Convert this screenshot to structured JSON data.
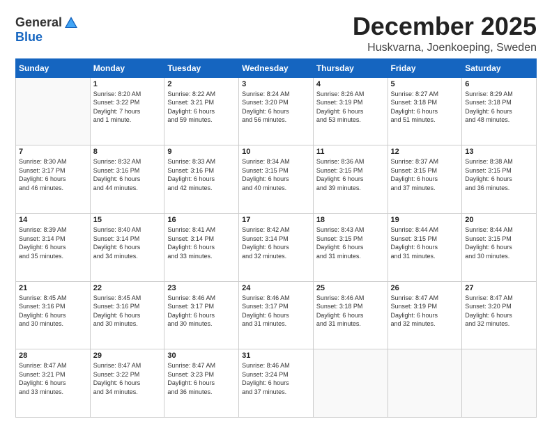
{
  "header": {
    "logo_general": "General",
    "logo_blue": "Blue",
    "month": "December 2025",
    "location": "Huskvarna, Joenkoeping, Sweden"
  },
  "days_of_week": [
    "Sunday",
    "Monday",
    "Tuesday",
    "Wednesday",
    "Thursday",
    "Friday",
    "Saturday"
  ],
  "weeks": [
    [
      {
        "day": "",
        "info": ""
      },
      {
        "day": "1",
        "info": "Sunrise: 8:20 AM\nSunset: 3:22 PM\nDaylight: 7 hours\nand 1 minute."
      },
      {
        "day": "2",
        "info": "Sunrise: 8:22 AM\nSunset: 3:21 PM\nDaylight: 6 hours\nand 59 minutes."
      },
      {
        "day": "3",
        "info": "Sunrise: 8:24 AM\nSunset: 3:20 PM\nDaylight: 6 hours\nand 56 minutes."
      },
      {
        "day": "4",
        "info": "Sunrise: 8:26 AM\nSunset: 3:19 PM\nDaylight: 6 hours\nand 53 minutes."
      },
      {
        "day": "5",
        "info": "Sunrise: 8:27 AM\nSunset: 3:18 PM\nDaylight: 6 hours\nand 51 minutes."
      },
      {
        "day": "6",
        "info": "Sunrise: 8:29 AM\nSunset: 3:18 PM\nDaylight: 6 hours\nand 48 minutes."
      }
    ],
    [
      {
        "day": "7",
        "info": "Sunrise: 8:30 AM\nSunset: 3:17 PM\nDaylight: 6 hours\nand 46 minutes."
      },
      {
        "day": "8",
        "info": "Sunrise: 8:32 AM\nSunset: 3:16 PM\nDaylight: 6 hours\nand 44 minutes."
      },
      {
        "day": "9",
        "info": "Sunrise: 8:33 AM\nSunset: 3:16 PM\nDaylight: 6 hours\nand 42 minutes."
      },
      {
        "day": "10",
        "info": "Sunrise: 8:34 AM\nSunset: 3:15 PM\nDaylight: 6 hours\nand 40 minutes."
      },
      {
        "day": "11",
        "info": "Sunrise: 8:36 AM\nSunset: 3:15 PM\nDaylight: 6 hours\nand 39 minutes."
      },
      {
        "day": "12",
        "info": "Sunrise: 8:37 AM\nSunset: 3:15 PM\nDaylight: 6 hours\nand 37 minutes."
      },
      {
        "day": "13",
        "info": "Sunrise: 8:38 AM\nSunset: 3:15 PM\nDaylight: 6 hours\nand 36 minutes."
      }
    ],
    [
      {
        "day": "14",
        "info": "Sunrise: 8:39 AM\nSunset: 3:14 PM\nDaylight: 6 hours\nand 35 minutes."
      },
      {
        "day": "15",
        "info": "Sunrise: 8:40 AM\nSunset: 3:14 PM\nDaylight: 6 hours\nand 34 minutes."
      },
      {
        "day": "16",
        "info": "Sunrise: 8:41 AM\nSunset: 3:14 PM\nDaylight: 6 hours\nand 33 minutes."
      },
      {
        "day": "17",
        "info": "Sunrise: 8:42 AM\nSunset: 3:14 PM\nDaylight: 6 hours\nand 32 minutes."
      },
      {
        "day": "18",
        "info": "Sunrise: 8:43 AM\nSunset: 3:15 PM\nDaylight: 6 hours\nand 31 minutes."
      },
      {
        "day": "19",
        "info": "Sunrise: 8:44 AM\nSunset: 3:15 PM\nDaylight: 6 hours\nand 31 minutes."
      },
      {
        "day": "20",
        "info": "Sunrise: 8:44 AM\nSunset: 3:15 PM\nDaylight: 6 hours\nand 30 minutes."
      }
    ],
    [
      {
        "day": "21",
        "info": "Sunrise: 8:45 AM\nSunset: 3:16 PM\nDaylight: 6 hours\nand 30 minutes."
      },
      {
        "day": "22",
        "info": "Sunrise: 8:45 AM\nSunset: 3:16 PM\nDaylight: 6 hours\nand 30 minutes."
      },
      {
        "day": "23",
        "info": "Sunrise: 8:46 AM\nSunset: 3:17 PM\nDaylight: 6 hours\nand 30 minutes."
      },
      {
        "day": "24",
        "info": "Sunrise: 8:46 AM\nSunset: 3:17 PM\nDaylight: 6 hours\nand 31 minutes."
      },
      {
        "day": "25",
        "info": "Sunrise: 8:46 AM\nSunset: 3:18 PM\nDaylight: 6 hours\nand 31 minutes."
      },
      {
        "day": "26",
        "info": "Sunrise: 8:47 AM\nSunset: 3:19 PM\nDaylight: 6 hours\nand 32 minutes."
      },
      {
        "day": "27",
        "info": "Sunrise: 8:47 AM\nSunset: 3:20 PM\nDaylight: 6 hours\nand 32 minutes."
      }
    ],
    [
      {
        "day": "28",
        "info": "Sunrise: 8:47 AM\nSunset: 3:21 PM\nDaylight: 6 hours\nand 33 minutes."
      },
      {
        "day": "29",
        "info": "Sunrise: 8:47 AM\nSunset: 3:22 PM\nDaylight: 6 hours\nand 34 minutes."
      },
      {
        "day": "30",
        "info": "Sunrise: 8:47 AM\nSunset: 3:23 PM\nDaylight: 6 hours\nand 36 minutes."
      },
      {
        "day": "31",
        "info": "Sunrise: 8:46 AM\nSunset: 3:24 PM\nDaylight: 6 hours\nand 37 minutes."
      },
      {
        "day": "",
        "info": ""
      },
      {
        "day": "",
        "info": ""
      },
      {
        "day": "",
        "info": ""
      }
    ]
  ]
}
